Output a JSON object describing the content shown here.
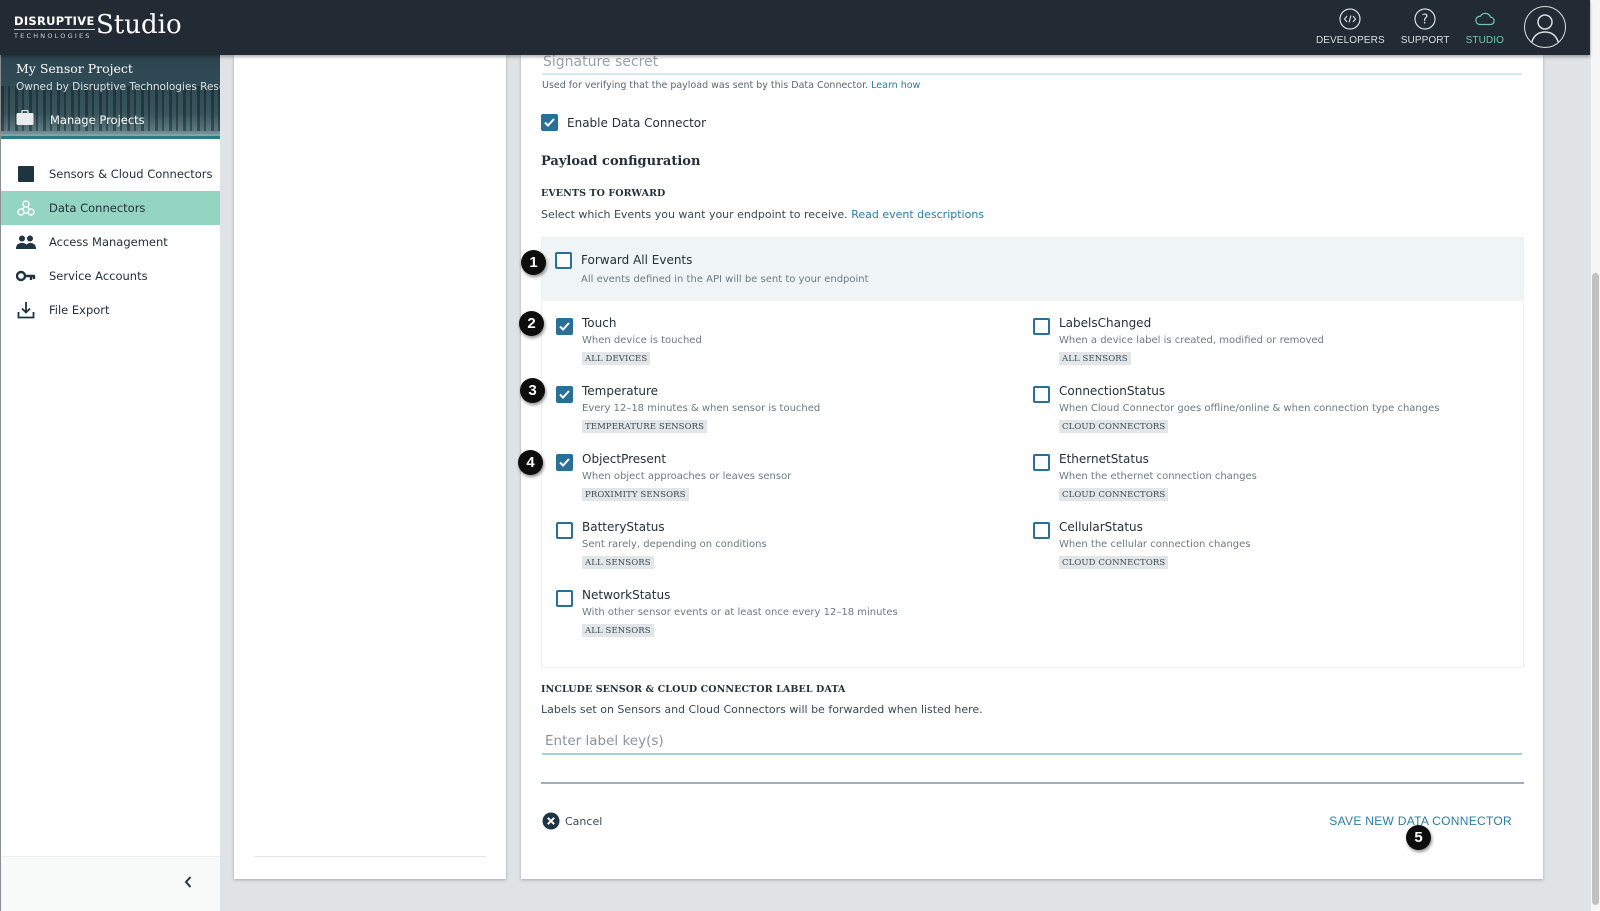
{
  "topbar": {
    "brand_top": "DISRUPTIVE",
    "brand_bottom": "TECHNOLOGIES",
    "app_title": "Studio",
    "nav": [
      {
        "label": "DEVELOPERS",
        "icon": "code-icon"
      },
      {
        "label": "SUPPORT",
        "icon": "help-icon"
      },
      {
        "label": "STUDIO",
        "icon": "cloud-icon",
        "active": true
      }
    ],
    "avatar_icon": "user-icon"
  },
  "sidebar": {
    "project_name": "My Sensor Project",
    "project_owner": "Owned by Disruptive Technologies Research",
    "manage_projects": "Manage Projects",
    "items": [
      {
        "label": "Sensors & Cloud Connectors",
        "icon": "sensor-square-icon"
      },
      {
        "label": "Data Connectors",
        "icon": "webhook-icon",
        "active": true
      },
      {
        "label": "Access Management",
        "icon": "people-icon"
      },
      {
        "label": "Service Accounts",
        "icon": "key-icon"
      },
      {
        "label": "File Export",
        "icon": "download-icon"
      }
    ],
    "collapse_icon": "chevron-left-icon"
  },
  "form": {
    "signature_placeholder": "Signature secret",
    "signature_help": "Used for verifying that the payload was sent by this Data Connector.",
    "signature_help_link": "Learn how",
    "enable_label": "Enable Data Connector",
    "enable_checked": true,
    "payload_title": "Payload configuration",
    "events_heading": "EVENTS TO FORWARD",
    "events_text": "Select which Events you want your endpoint to receive.",
    "events_link": "Read event descriptions",
    "forward_all": {
      "name": "Forward All Events",
      "desc": "All events defined in the API will be sent to your endpoint",
      "checked": false
    },
    "events_left": [
      {
        "name": "Touch",
        "desc": "When device is touched",
        "tag": "ALL DEVICES",
        "checked": true
      },
      {
        "name": "Temperature",
        "desc": "Every 12–18 minutes & when sensor is touched",
        "tag": "TEMPERATURE SENSORS",
        "checked": true
      },
      {
        "name": "ObjectPresent",
        "desc": "When object approaches or leaves sensor",
        "tag": "PROXIMITY SENSORS",
        "checked": true
      },
      {
        "name": "BatteryStatus",
        "desc": "Sent rarely, depending on conditions",
        "tag": "ALL SENSORS",
        "checked": false
      },
      {
        "name": "NetworkStatus",
        "desc": "With other sensor events or at least once every 12–18 minutes",
        "tag": "ALL SENSORS",
        "checked": false
      }
    ],
    "events_right": [
      {
        "name": "LabelsChanged",
        "desc": "When a device label is created, modified or removed",
        "tag": "ALL SENSORS",
        "checked": false
      },
      {
        "name": "ConnectionStatus",
        "desc": "When Cloud Connector goes offline/online & when connection type changes",
        "tag": "CLOUD CONNECTORS",
        "checked": false
      },
      {
        "name": "EthernetStatus",
        "desc": "When the ethernet connection changes",
        "tag": "CLOUD CONNECTORS",
        "checked": false
      },
      {
        "name": "CellularStatus",
        "desc": "When the cellular connection changes",
        "tag": "CLOUD CONNECTORS",
        "checked": false
      }
    ],
    "labels_heading": "INCLUDE SENSOR & CLOUD CONNECTOR LABEL DATA",
    "labels_text": "Labels set on Sensors and Cloud Connectors will be forwarded when listed here.",
    "labels_placeholder": "Enter label key(s)",
    "cancel_label": "Cancel",
    "save_label": "SAVE NEW DATA CONNECTOR"
  },
  "annotations": [
    "1",
    "2",
    "3",
    "4",
    "5"
  ],
  "colors": {
    "topbar": "#222b33",
    "accent_teal": "#93d5c1",
    "checkbox_blue": "#2a6f96",
    "link_blue": "#2a7ea7"
  }
}
